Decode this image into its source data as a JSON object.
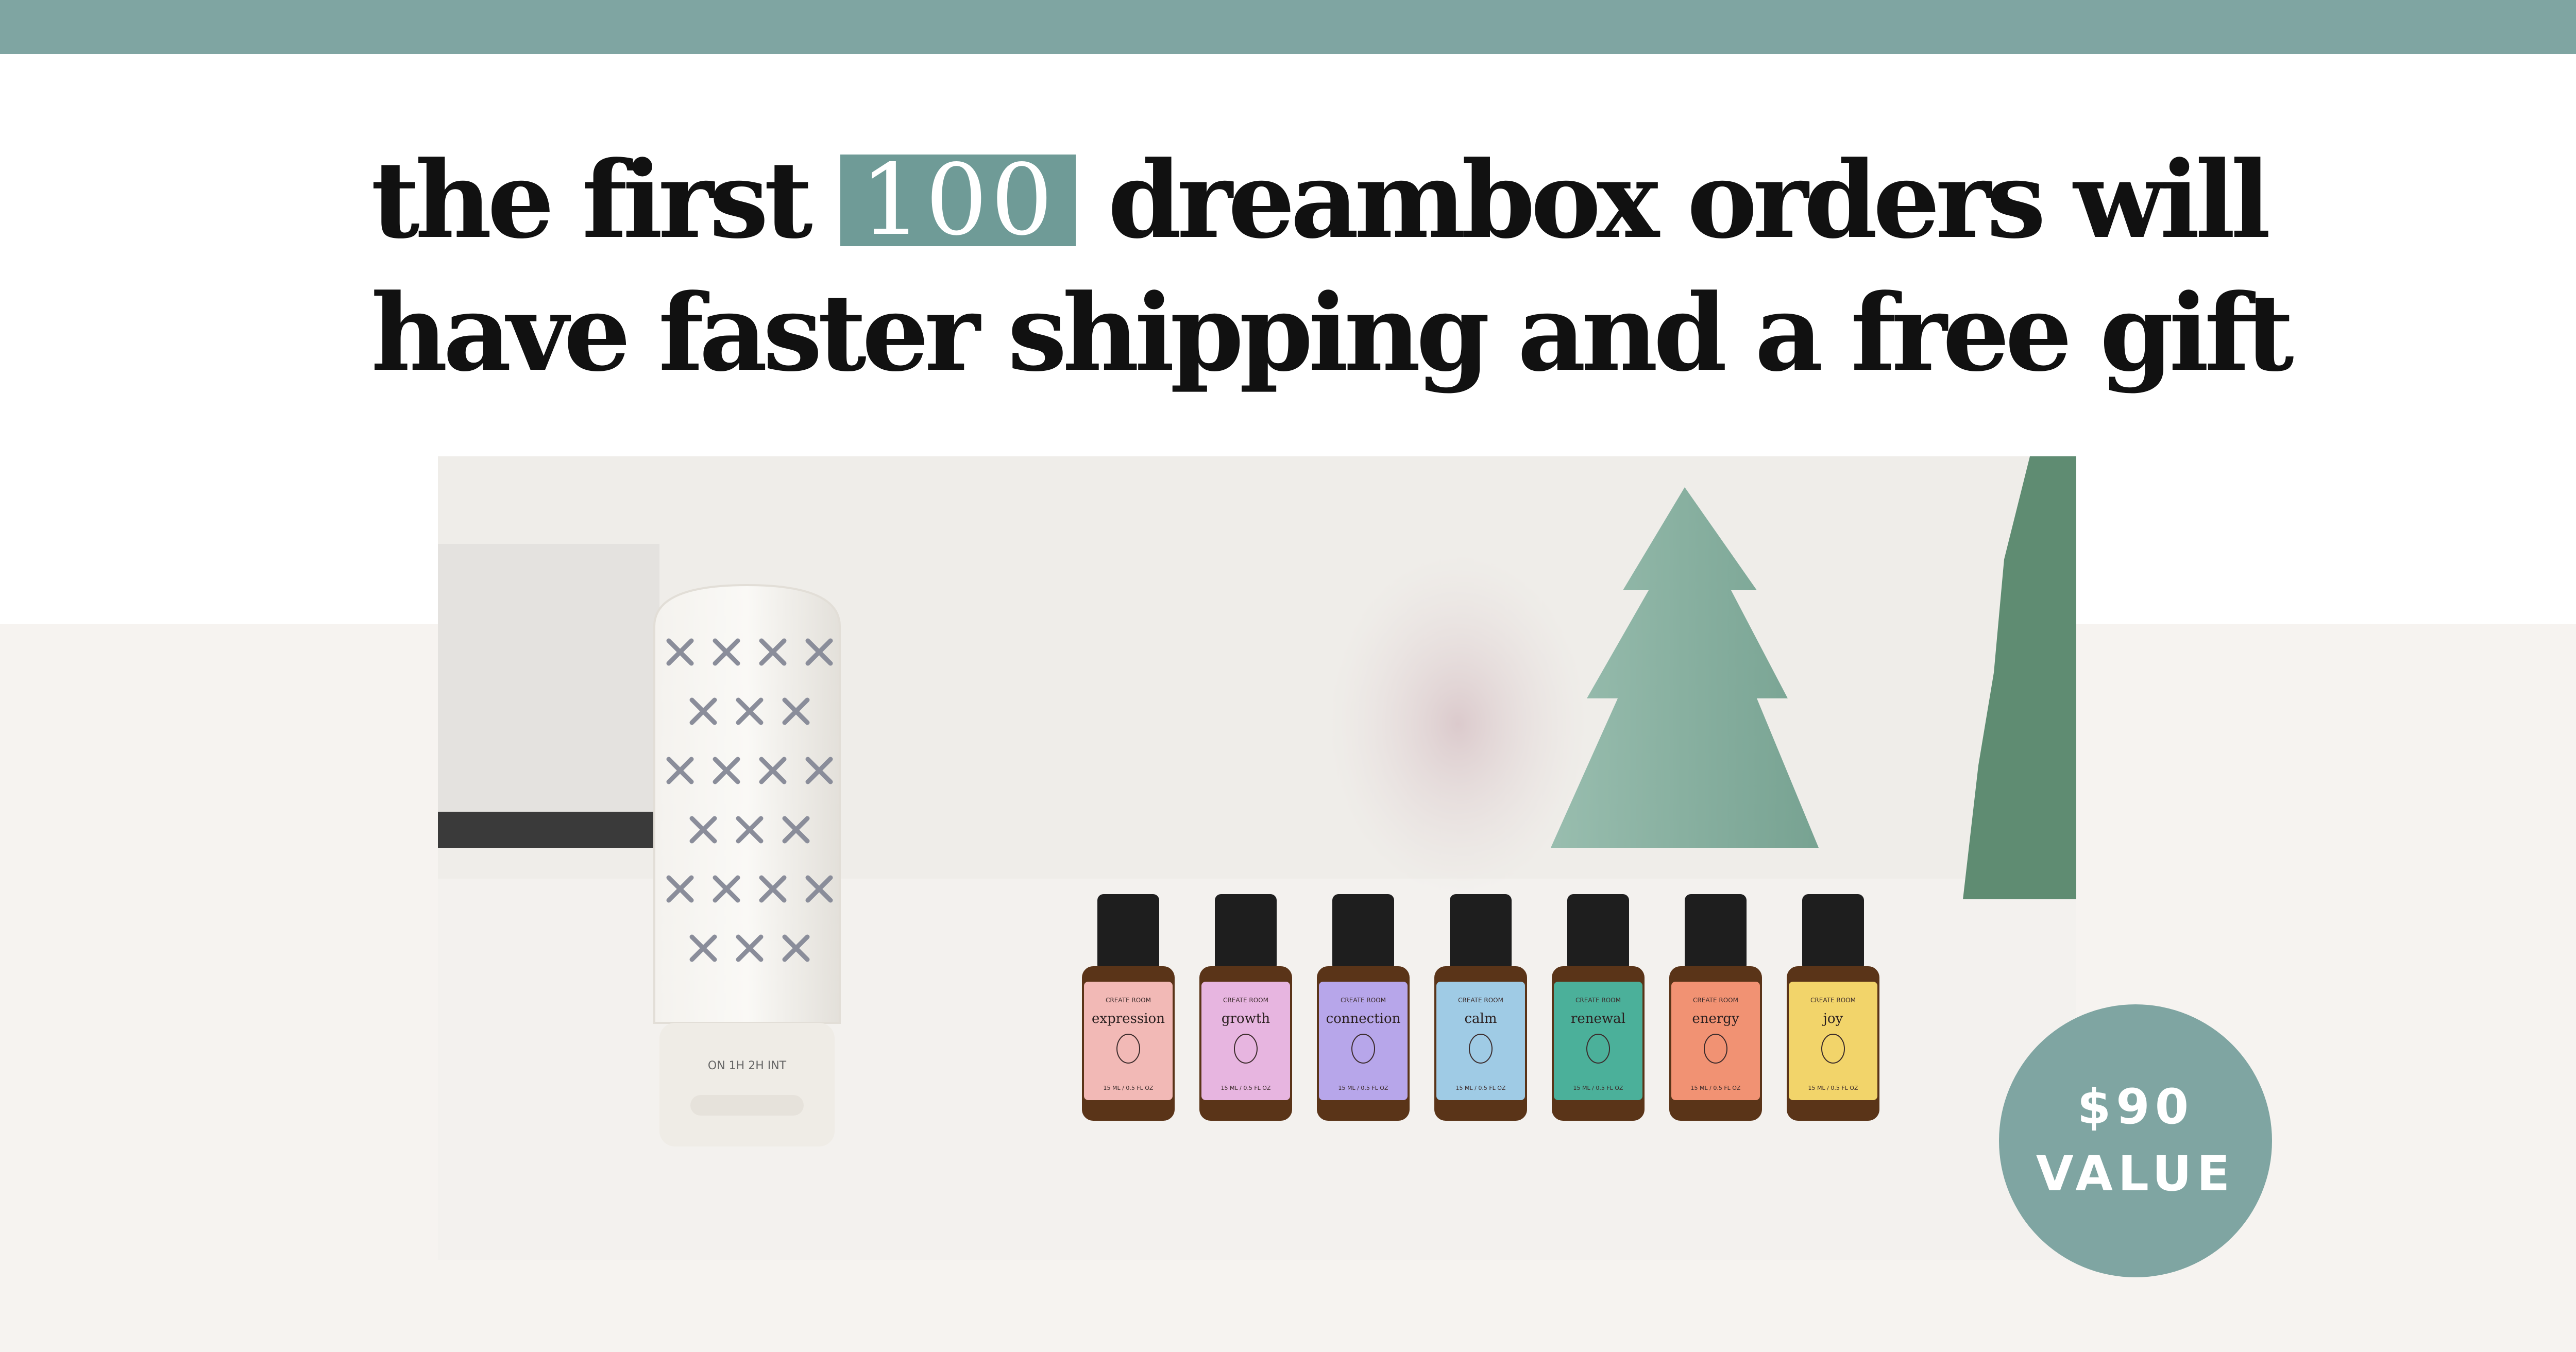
{
  "headline": {
    "line1_before": "the first",
    "highlight": "100",
    "line1_after": "dreambox orders will",
    "line2": "have faster shipping and a free gift"
  },
  "photo": {
    "bottles": [
      {
        "brand": "CREATE ROOM",
        "name": "expression",
        "volume": "15 ML / 0.5 FL OZ",
        "label_color": "#f2b9b6"
      },
      {
        "brand": "CREATE ROOM",
        "name": "growth",
        "volume": "15 ML / 0.5 FL OZ",
        "label_color": "#e7b5e0"
      },
      {
        "brand": "CREATE ROOM",
        "name": "connection",
        "volume": "15 ML / 0.5 FL OZ",
        "label_color": "#b7a6ea"
      },
      {
        "brand": "CREATE ROOM",
        "name": "calm",
        "volume": "15 ML / 0.5 FL OZ",
        "label_color": "#9fcbe5"
      },
      {
        "brand": "CREATE ROOM",
        "name": "renewal",
        "volume": "15 ML / 0.5 FL OZ",
        "label_color": "#4bb09a"
      },
      {
        "brand": "CREATE ROOM",
        "name": "energy",
        "volume": "15 ML / 0.5 FL OZ",
        "label_color": "#f19273"
      },
      {
        "brand": "CREATE ROOM",
        "name": "joy",
        "volume": "15 ML / 0.5 FL OZ",
        "label_color": "#f2d46a"
      }
    ],
    "diffuser_buttons": "ON 1H 2H INT"
  },
  "badge": {
    "line1": "$90",
    "line2": "VALUE"
  },
  "colors": {
    "accent": "#7fa5a2",
    "highlight": "#6f9b97",
    "text": "#111111",
    "lower_background": "#f6f3f0"
  }
}
